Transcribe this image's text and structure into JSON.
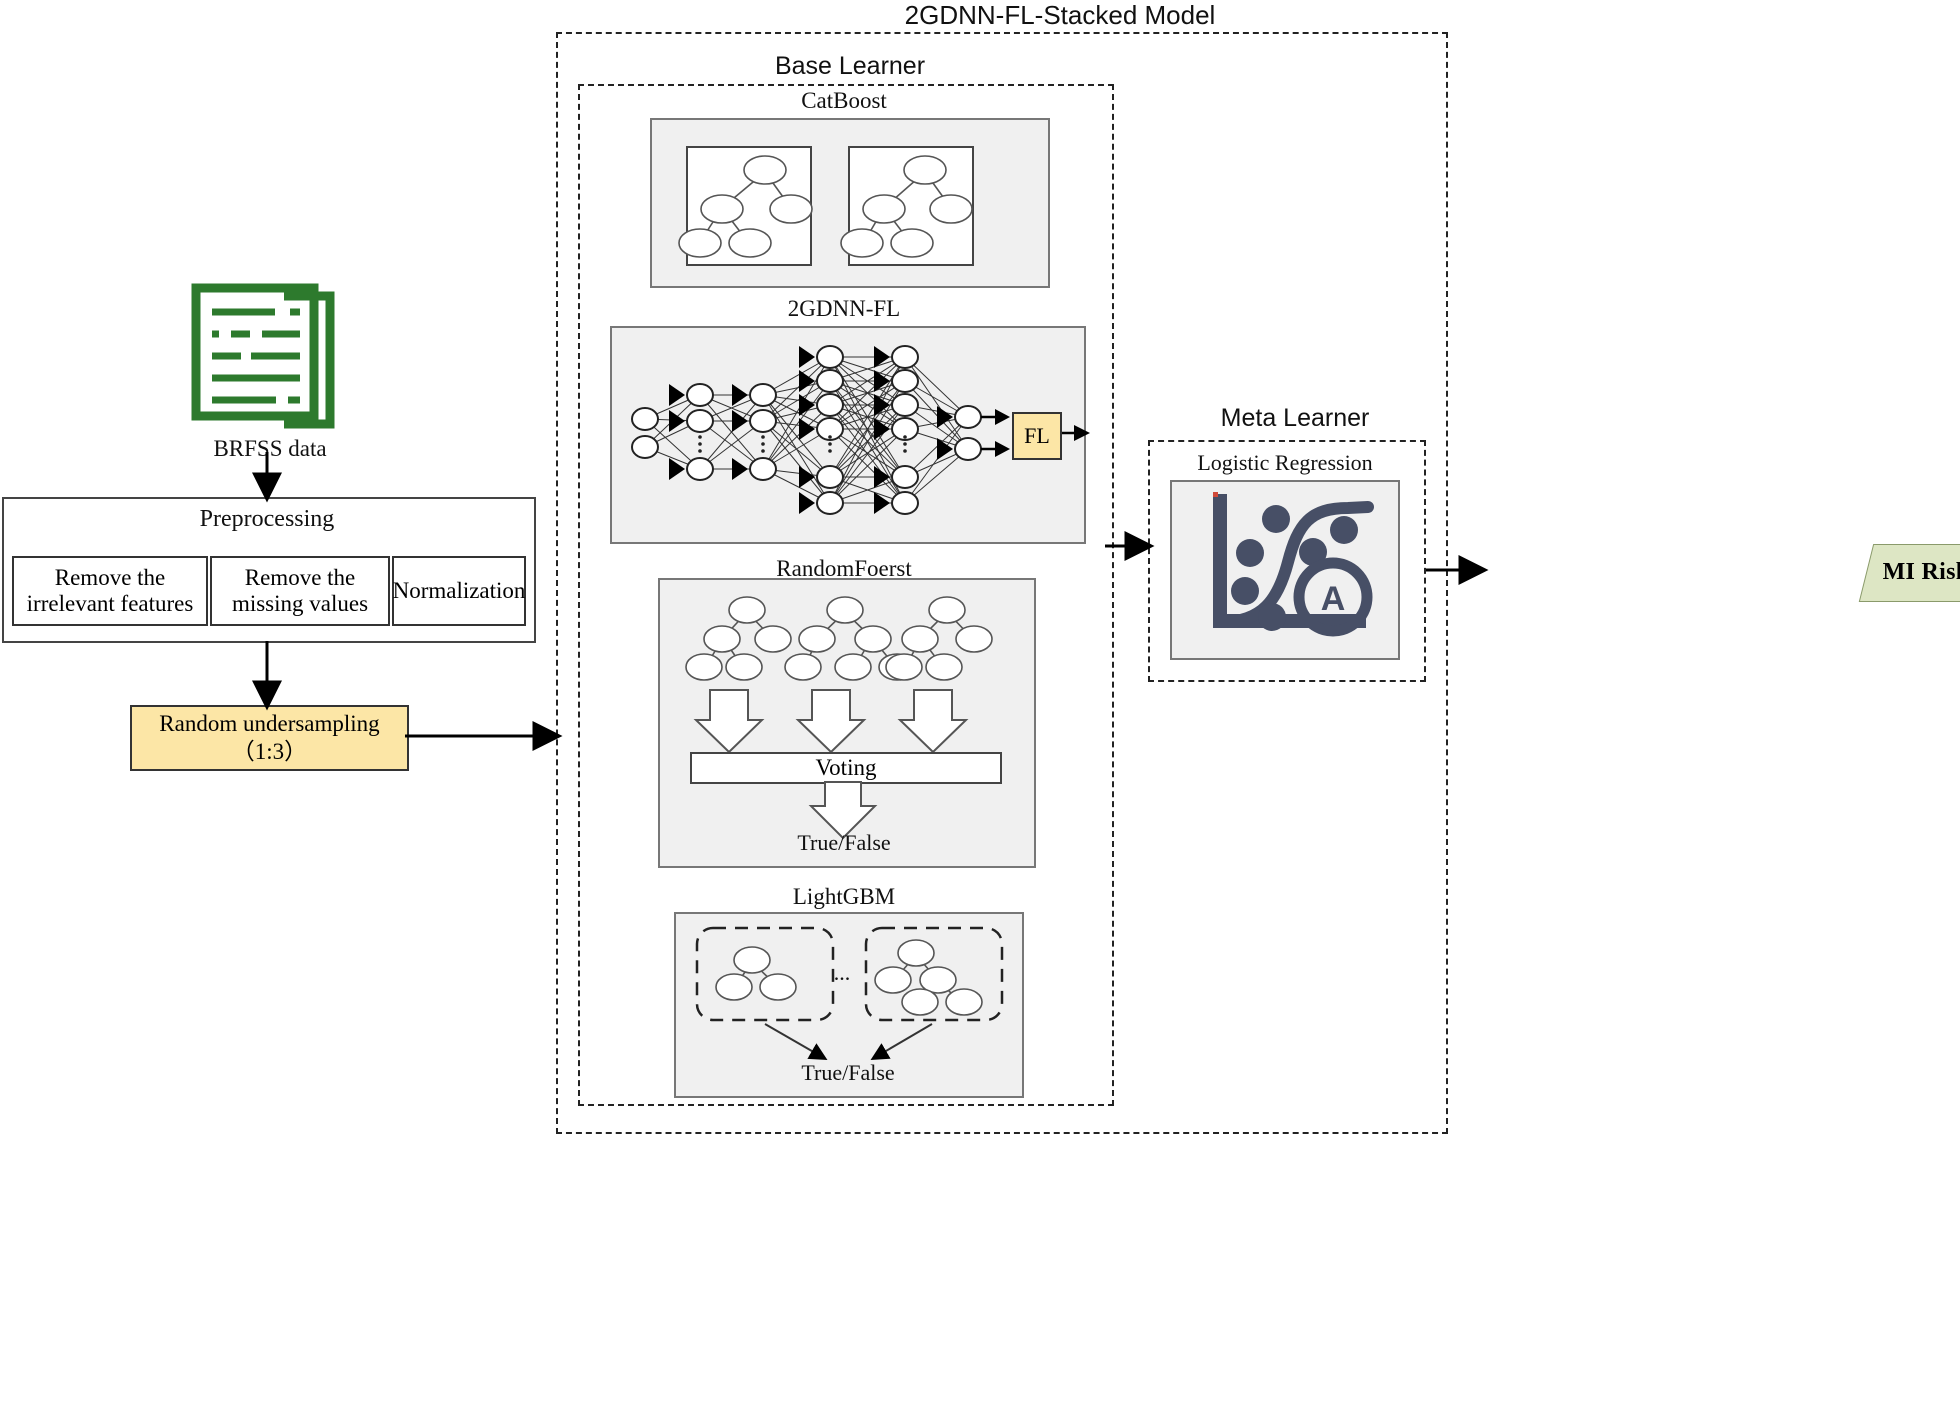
{
  "title": "2GDNN-FL-Stacked Model",
  "left": {
    "data_icon_label": "BRFSS data",
    "data_icon_name": "document-stack-icon",
    "data_icon_color": "#2d7a2d",
    "preprocessing": {
      "title": "Preprocessing",
      "steps": [
        "Remove the\nirrelevant features",
        "Remove the\nmissing values",
        "Normalization"
      ],
      "step_1_line1": "Remove the",
      "step_1_line2": "irrelevant features",
      "step_2_line1": "Remove the",
      "step_2_line2": "missing values",
      "step_3_line1": "Normalization"
    },
    "undersampling": {
      "line1": "Random undersampling",
      "line2": "（1:3）",
      "color": "#fce6a6"
    }
  },
  "base_learner": {
    "title": "Base Learner",
    "models": {
      "catboost": {
        "title": "CatBoost",
        "tree_count": 2
      },
      "dnn": {
        "title": "2GDNN-FL",
        "fl_label": "FL",
        "fl_color": "#fce6a6",
        "layer_sizes": [
          2,
          3,
          3,
          6,
          6,
          2
        ],
        "ellipsis": "⋮"
      },
      "random_forest": {
        "title": "RandomFoerst",
        "tree_count": 3,
        "voting_label": "Voting",
        "output_label": "True/False"
      },
      "lightgbm": {
        "title": "LightGBM",
        "ellipsis": "...",
        "output_label": "True/False",
        "tree_count": 2
      }
    }
  },
  "meta_learner": {
    "title": "Meta Learner",
    "model_title": "Logistic Regression",
    "icon_name": "logistic-curve-scatter-icon",
    "icon_color": "#474f66",
    "icon_letter": "A"
  },
  "output": {
    "label": "MI Risk",
    "color": "#dde6c4"
  }
}
